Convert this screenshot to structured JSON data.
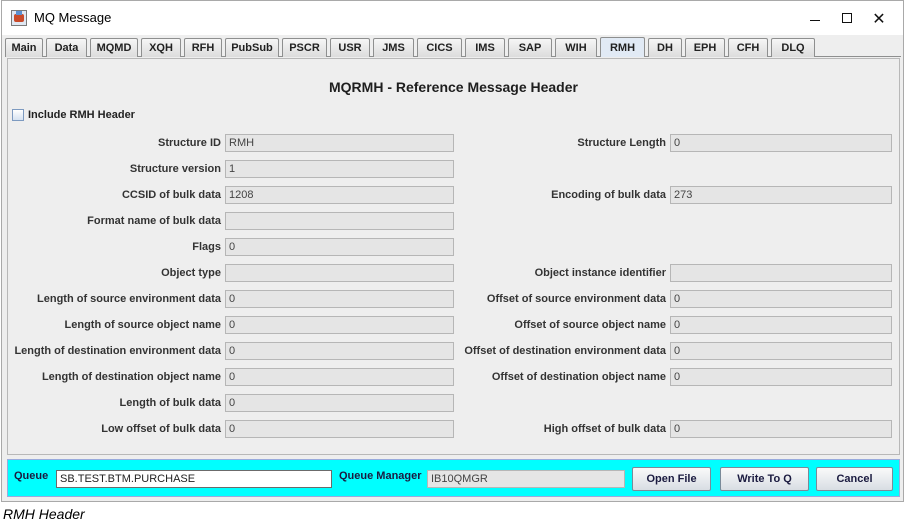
{
  "window": {
    "title": "MQ Message",
    "minimize_glyph": "",
    "maximize_glyph": "",
    "close_glyph": "✕"
  },
  "tabs": [
    {
      "label": "Main"
    },
    {
      "label": "Data"
    },
    {
      "label": "MQMD"
    },
    {
      "label": "XQH"
    },
    {
      "label": "RFH"
    },
    {
      "label": "PubSub"
    },
    {
      "label": "PSCR"
    },
    {
      "label": "USR"
    },
    {
      "label": "JMS"
    },
    {
      "label": "CICS"
    },
    {
      "label": "IMS"
    },
    {
      "label": "SAP"
    },
    {
      "label": "WIH"
    },
    {
      "label": "RMH"
    },
    {
      "label": "DH"
    },
    {
      "label": "EPH"
    },
    {
      "label": "CFH"
    },
    {
      "label": "DLQ"
    }
  ],
  "active_tab": "RMH",
  "panel": {
    "title": "MQRMH - Reference Message Header",
    "include_checkbox_label": "Include RMH Header",
    "include_checked": false
  },
  "left_fields": [
    {
      "label": "Structure ID",
      "value": "RMH"
    },
    {
      "label": "Structure version",
      "value": "1"
    },
    {
      "label": "CCSID of bulk data",
      "value": "1208"
    },
    {
      "label": "Format name of bulk data",
      "value": ""
    },
    {
      "label": "Flags",
      "value": "0"
    },
    {
      "label": "Object type",
      "value": ""
    },
    {
      "label": "Length of source environment data",
      "value": "0"
    },
    {
      "label": "Length of source object name",
      "value": "0"
    },
    {
      "label": "Length of destination environment data",
      "value": "0"
    },
    {
      "label": "Length of destination object name",
      "value": "0"
    },
    {
      "label": "Length of bulk data",
      "value": "0"
    },
    {
      "label": "Low offset of bulk data",
      "value": "0"
    }
  ],
  "right_fields": [
    {
      "label": "Structure Length",
      "value": "0"
    },
    {
      "label": "Encoding of bulk data",
      "value": "273"
    },
    {
      "label": "Object instance identifier",
      "value": ""
    },
    {
      "label": "Offset of source environment data",
      "value": "0"
    },
    {
      "label": "Offset of source object name",
      "value": "0"
    },
    {
      "label": "Offset of destination environment data",
      "value": "0"
    },
    {
      "label": "Offset of destination object name",
      "value": "0"
    },
    {
      "label": "High offset of bulk data",
      "value": "0"
    }
  ],
  "footer": {
    "queue_label": "Queue",
    "queue_value": "SB.TEST.BTM.PURCHASE",
    "qmgr_label": "Queue Manager",
    "qmgr_value": "IB10QMGR",
    "open_file_label": "Open File",
    "write_label": "Write To Q",
    "cancel_label": "Cancel",
    "background_color": "#00ffff"
  },
  "caption": "RMH Header"
}
